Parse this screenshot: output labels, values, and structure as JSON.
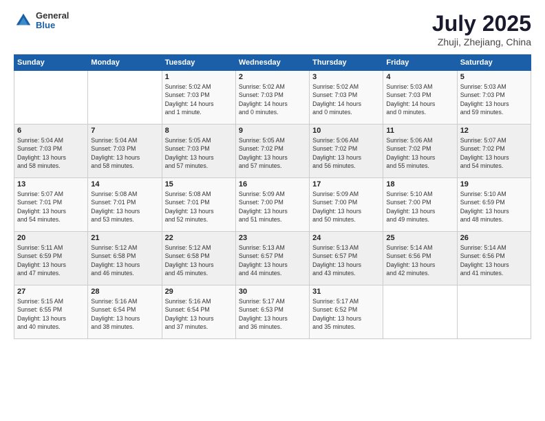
{
  "logo": {
    "general": "General",
    "blue": "Blue"
  },
  "title": "July 2025",
  "subtitle": "Zhuji, Zhejiang, China",
  "days_header": [
    "Sunday",
    "Monday",
    "Tuesday",
    "Wednesday",
    "Thursday",
    "Friday",
    "Saturday"
  ],
  "weeks": [
    [
      {
        "day": "",
        "info": ""
      },
      {
        "day": "",
        "info": ""
      },
      {
        "day": "1",
        "info": "Sunrise: 5:02 AM\nSunset: 7:03 PM\nDaylight: 14 hours\nand 1 minute."
      },
      {
        "day": "2",
        "info": "Sunrise: 5:02 AM\nSunset: 7:03 PM\nDaylight: 14 hours\nand 0 minutes."
      },
      {
        "day": "3",
        "info": "Sunrise: 5:02 AM\nSunset: 7:03 PM\nDaylight: 14 hours\nand 0 minutes."
      },
      {
        "day": "4",
        "info": "Sunrise: 5:03 AM\nSunset: 7:03 PM\nDaylight: 14 hours\nand 0 minutes."
      },
      {
        "day": "5",
        "info": "Sunrise: 5:03 AM\nSunset: 7:03 PM\nDaylight: 13 hours\nand 59 minutes."
      }
    ],
    [
      {
        "day": "6",
        "info": "Sunrise: 5:04 AM\nSunset: 7:03 PM\nDaylight: 13 hours\nand 58 minutes."
      },
      {
        "day": "7",
        "info": "Sunrise: 5:04 AM\nSunset: 7:03 PM\nDaylight: 13 hours\nand 58 minutes."
      },
      {
        "day": "8",
        "info": "Sunrise: 5:05 AM\nSunset: 7:03 PM\nDaylight: 13 hours\nand 57 minutes."
      },
      {
        "day": "9",
        "info": "Sunrise: 5:05 AM\nSunset: 7:02 PM\nDaylight: 13 hours\nand 57 minutes."
      },
      {
        "day": "10",
        "info": "Sunrise: 5:06 AM\nSunset: 7:02 PM\nDaylight: 13 hours\nand 56 minutes."
      },
      {
        "day": "11",
        "info": "Sunrise: 5:06 AM\nSunset: 7:02 PM\nDaylight: 13 hours\nand 55 minutes."
      },
      {
        "day": "12",
        "info": "Sunrise: 5:07 AM\nSunset: 7:02 PM\nDaylight: 13 hours\nand 54 minutes."
      }
    ],
    [
      {
        "day": "13",
        "info": "Sunrise: 5:07 AM\nSunset: 7:01 PM\nDaylight: 13 hours\nand 54 minutes."
      },
      {
        "day": "14",
        "info": "Sunrise: 5:08 AM\nSunset: 7:01 PM\nDaylight: 13 hours\nand 53 minutes."
      },
      {
        "day": "15",
        "info": "Sunrise: 5:08 AM\nSunset: 7:01 PM\nDaylight: 13 hours\nand 52 minutes."
      },
      {
        "day": "16",
        "info": "Sunrise: 5:09 AM\nSunset: 7:00 PM\nDaylight: 13 hours\nand 51 minutes."
      },
      {
        "day": "17",
        "info": "Sunrise: 5:09 AM\nSunset: 7:00 PM\nDaylight: 13 hours\nand 50 minutes."
      },
      {
        "day": "18",
        "info": "Sunrise: 5:10 AM\nSunset: 7:00 PM\nDaylight: 13 hours\nand 49 minutes."
      },
      {
        "day": "19",
        "info": "Sunrise: 5:10 AM\nSunset: 6:59 PM\nDaylight: 13 hours\nand 48 minutes."
      }
    ],
    [
      {
        "day": "20",
        "info": "Sunrise: 5:11 AM\nSunset: 6:59 PM\nDaylight: 13 hours\nand 47 minutes."
      },
      {
        "day": "21",
        "info": "Sunrise: 5:12 AM\nSunset: 6:58 PM\nDaylight: 13 hours\nand 46 minutes."
      },
      {
        "day": "22",
        "info": "Sunrise: 5:12 AM\nSunset: 6:58 PM\nDaylight: 13 hours\nand 45 minutes."
      },
      {
        "day": "23",
        "info": "Sunrise: 5:13 AM\nSunset: 6:57 PM\nDaylight: 13 hours\nand 44 minutes."
      },
      {
        "day": "24",
        "info": "Sunrise: 5:13 AM\nSunset: 6:57 PM\nDaylight: 13 hours\nand 43 minutes."
      },
      {
        "day": "25",
        "info": "Sunrise: 5:14 AM\nSunset: 6:56 PM\nDaylight: 13 hours\nand 42 minutes."
      },
      {
        "day": "26",
        "info": "Sunrise: 5:14 AM\nSunset: 6:56 PM\nDaylight: 13 hours\nand 41 minutes."
      }
    ],
    [
      {
        "day": "27",
        "info": "Sunrise: 5:15 AM\nSunset: 6:55 PM\nDaylight: 13 hours\nand 40 minutes."
      },
      {
        "day": "28",
        "info": "Sunrise: 5:16 AM\nSunset: 6:54 PM\nDaylight: 13 hours\nand 38 minutes."
      },
      {
        "day": "29",
        "info": "Sunrise: 5:16 AM\nSunset: 6:54 PM\nDaylight: 13 hours\nand 37 minutes."
      },
      {
        "day": "30",
        "info": "Sunrise: 5:17 AM\nSunset: 6:53 PM\nDaylight: 13 hours\nand 36 minutes."
      },
      {
        "day": "31",
        "info": "Sunrise: 5:17 AM\nSunset: 6:52 PM\nDaylight: 13 hours\nand 35 minutes."
      },
      {
        "day": "",
        "info": ""
      },
      {
        "day": "",
        "info": ""
      }
    ]
  ]
}
